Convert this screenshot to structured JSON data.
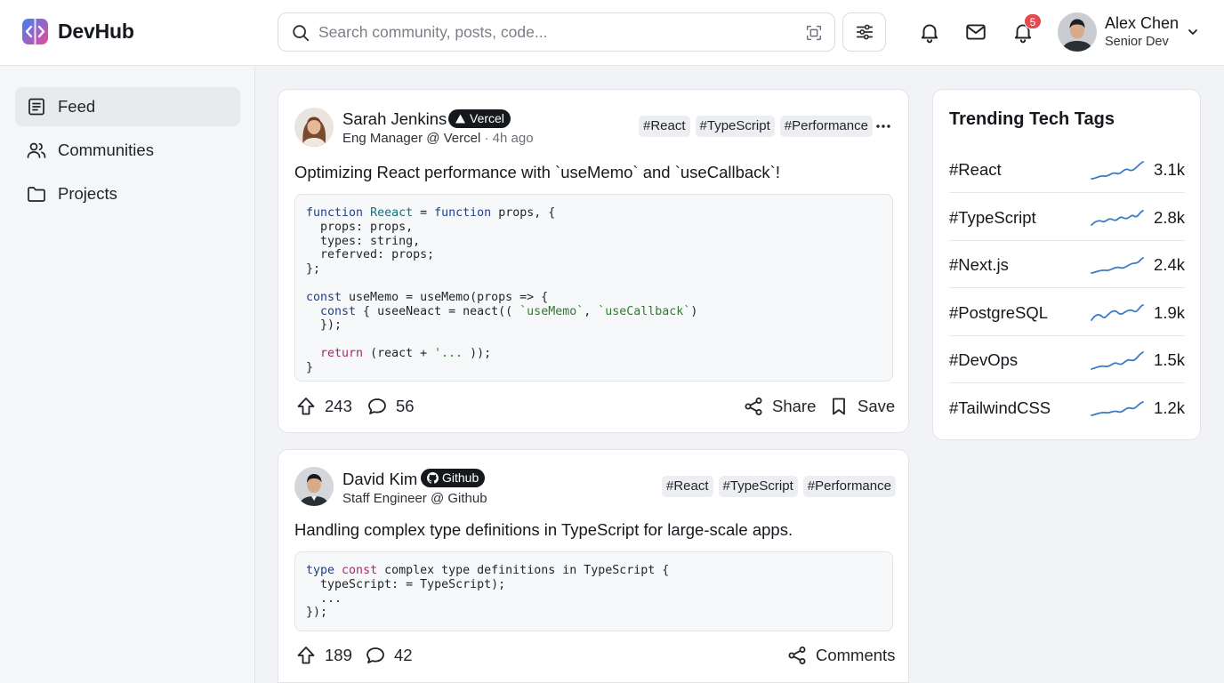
{
  "app": {
    "name": "DevHub"
  },
  "search": {
    "placeholder": "Search community, posts, code..."
  },
  "notifications": {
    "count": "5"
  },
  "user": {
    "name": "Alex Chen",
    "role": "Senior Dev"
  },
  "sidebar": {
    "items": [
      {
        "label": "Feed",
        "icon": "feed-icon",
        "active": true
      },
      {
        "label": "Communities",
        "icon": "users-icon",
        "active": false
      },
      {
        "label": "Projects",
        "icon": "folder-icon",
        "active": false
      }
    ]
  },
  "posts": [
    {
      "author": "Sarah Jenkins",
      "company_badge": "Vercel",
      "role": "Eng Manager @ Vercel",
      "time": "4h ago",
      "tags": [
        "#React",
        "#TypeScript",
        "#Performance"
      ],
      "title": "Optimizing React performance with `useMemo` and `useCallback`!",
      "upvotes": "243",
      "comments": "56",
      "share_label": "Share",
      "save_label": "Save"
    },
    {
      "author": "David Kim",
      "company_badge": "Github",
      "role": "Staff Engineer @ Github",
      "tags": [
        "#React",
        "#TypeScript",
        "#Performance"
      ],
      "title": "Handling complex type definitions in TypeScript for large-scale apps.",
      "upvotes": "189",
      "comments": "42",
      "comments_label": "Comments"
    }
  ],
  "trending": {
    "title": "Trending Tech Tags",
    "accent_color": "#3a7bc8",
    "items": [
      {
        "tag": "#React",
        "count": "3.1k"
      },
      {
        "tag": "#TypeScript",
        "count": "2.8k"
      },
      {
        "tag": "#Next.js",
        "count": "2.4k"
      },
      {
        "tag": "#PostgreSQL",
        "count": "1.9k"
      },
      {
        "tag": "#DevOps",
        "count": "1.5k"
      },
      {
        "tag": "#TailwindCSS",
        "count": "1.2k"
      }
    ]
  }
}
